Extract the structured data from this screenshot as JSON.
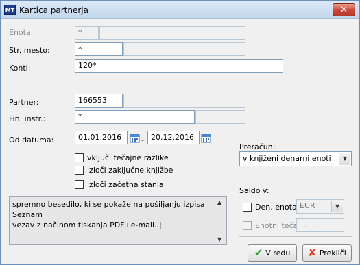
{
  "window": {
    "title": "Kartica partnerja",
    "app_icon_text": "MT",
    "close_glyph": "✕"
  },
  "form": {
    "enota": {
      "label": "Enota:",
      "value": "*",
      "description": ""
    },
    "str_mesto": {
      "label": "Str. mesto:",
      "value": "*",
      "description": ""
    },
    "konti": {
      "label": "Konti:",
      "value": "120*"
    },
    "partner": {
      "label": "Partner:",
      "value": "166553",
      "description": ""
    },
    "fin_instr": {
      "label": "Fin. instr.:",
      "value": "*",
      "description": ""
    },
    "od_datuma": {
      "label": "Od datuma:",
      "from": "01.01.2016",
      "separator": "-",
      "to": "20.12.2016"
    }
  },
  "options": {
    "vkljuci_tecajne": "vključi tečajne razlike",
    "izloci_zakljucne": "izloči zaključne knjižbe",
    "izloci_zacetna": "izloči začetna stanja"
  },
  "preracun": {
    "label": "Preračun:",
    "selected": "v knjiženi denarni enoti"
  },
  "note": {
    "text": "spremno besedilo, ki se pokaže na pošiljanju izpisa Seznam\nvezav z načinom tiskanja PDF+e-mail..|"
  },
  "saldo": {
    "label": "Saldo v:",
    "den_enota_label": "Den. enota:",
    "den_enota_value": "EUR",
    "enotni_tecaj_label": "Enotni tečaj:",
    "enotni_tecaj_value": "  .  ."
  },
  "buttons": {
    "ok": "V redu",
    "cancel": "Prekliči"
  },
  "icons": {
    "calendar": "calendar-icon",
    "check": "check-icon",
    "cross": "cross-icon",
    "chevron": "chevron-down-icon"
  }
}
